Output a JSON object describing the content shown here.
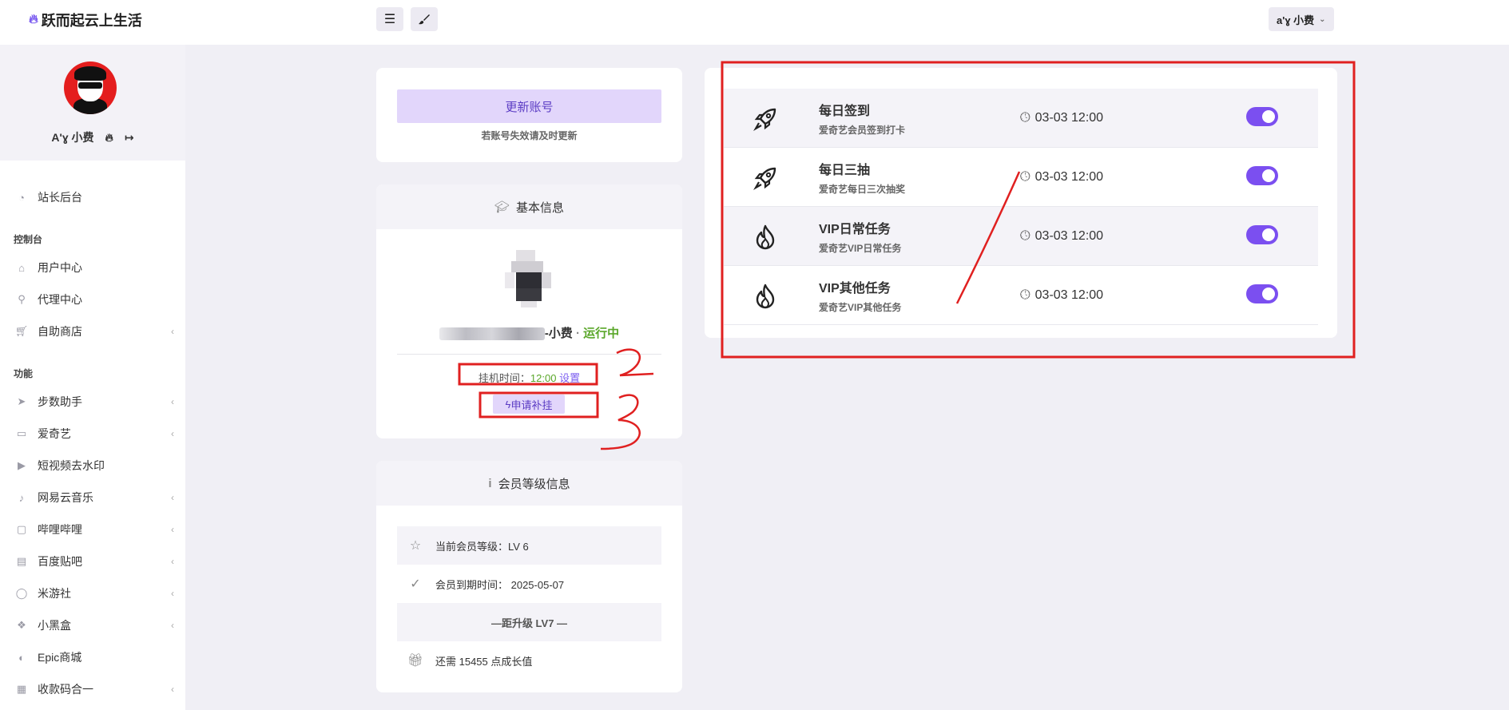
{
  "header": {
    "brand": "跃而起云上生活",
    "user_menu": "a'ɣ 小费"
  },
  "sidebar": {
    "profile_name": "A'ɣ 小费",
    "top_item": "站长后台",
    "section_console": "控制台",
    "console_items": [
      "用户中心",
      "代理中心",
      "自助商店"
    ],
    "section_features": "功能",
    "feature_items": [
      "步数助手",
      "爱奇艺",
      "短视频去水印",
      "网易云音乐",
      "哔哩哔哩",
      "百度贴吧",
      "米游社",
      "小黑盒",
      "Epic商城",
      "收款码合一"
    ]
  },
  "account_card": {
    "update_button": "更新账号",
    "hint": "若账号失效请及时更新"
  },
  "basic_info": {
    "title": "基本信息",
    "account_suffix": "-小费",
    "separator": " · ",
    "status": "运行中",
    "hang_label": "挂机时间：",
    "hang_time": "12:00",
    "set_link": "设置",
    "apply_button": "申请补挂"
  },
  "member": {
    "title": "会员等级信息",
    "level_text": "当前会员等级：LV 6",
    "expire_text": "会员到期时间：  2025-05-07",
    "upgrade_text": "—距升级 LV7 —",
    "remaining_text": "还需 15455 点成长值"
  },
  "tasks": [
    {
      "title": "每日签到",
      "desc": "爱奇艺会员签到打卡",
      "time": "03-03 12:00",
      "icon": "rocket-icon",
      "enabled": true
    },
    {
      "title": "每日三抽",
      "desc": "爱奇艺每日三次抽奖",
      "time": "03-03 12:00",
      "icon": "rocket-icon",
      "enabled": true
    },
    {
      "title": "VIP日常任务",
      "desc": "爱奇艺VIP日常任务",
      "time": "03-03 12:00",
      "icon": "flame-icon",
      "enabled": true
    },
    {
      "title": "VIP其他任务",
      "desc": "爱奇艺VIP其他任务",
      "time": "03-03 12:00",
      "icon": "flame-icon",
      "enabled": true
    }
  ],
  "annotations": {
    "marks": [
      "2",
      "3"
    ]
  },
  "colors": {
    "accent": "#7b4ff0",
    "accent_light": "#e2d6fb",
    "success": "#5aa72a",
    "annotation": "#e02020"
  }
}
